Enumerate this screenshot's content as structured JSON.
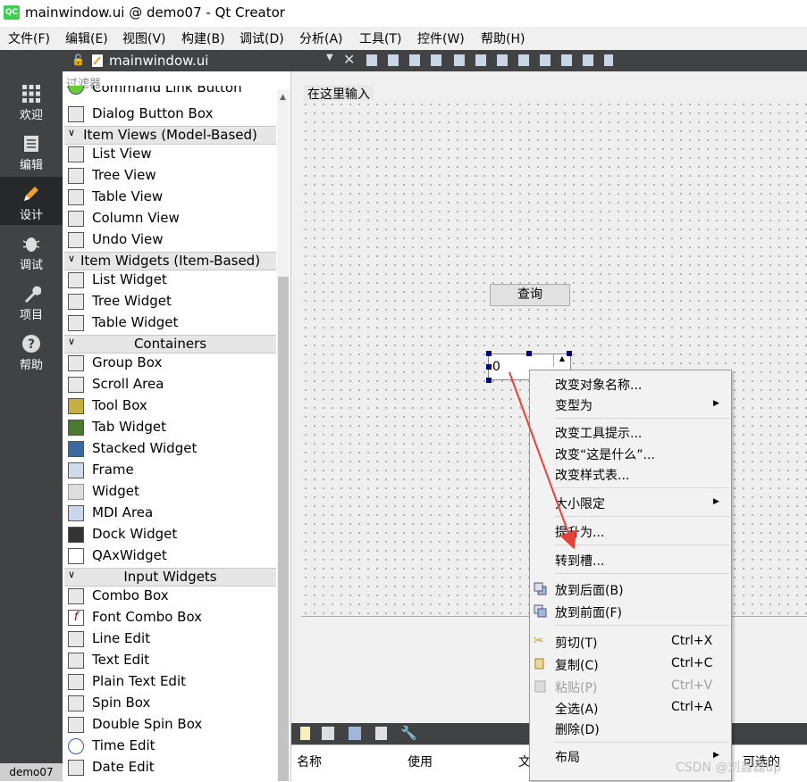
{
  "window": {
    "title": "mainwindow.ui @ demo07 - Qt Creator",
    "logo_text": "QC"
  },
  "menubar": {
    "items": [
      "文件(F)",
      "编辑(E)",
      "视图(V)",
      "构建(B)",
      "调试(D)",
      "分析(A)",
      "工具(T)",
      "控件(W)",
      "帮助(H)"
    ]
  },
  "modes": [
    "欢迎",
    "编辑",
    "设计",
    "调试",
    "项目",
    "帮助"
  ],
  "mode_footer": "demo07",
  "editor": {
    "file_name": "mainwindow.ui"
  },
  "widget_box": {
    "filter_placeholder": "过滤器",
    "partial_top": "Command Link Button",
    "dialog_button_box": "Dialog Button Box",
    "categories": {
      "item_views": "Item Views (Model-Based)",
      "item_widgets": "Item Widgets (Item-Based)",
      "containers": "Containers",
      "input_widgets": "Input Widgets"
    },
    "item_views": [
      "List View",
      "Tree View",
      "Table View",
      "Column View",
      "Undo View"
    ],
    "item_widgets": [
      "List Widget",
      "Tree Widget",
      "Table Widget"
    ],
    "containers": [
      "Group Box",
      "Scroll Area",
      "Tool Box",
      "Tab Widget",
      "Stacked Widget",
      "Frame",
      "Widget",
      "MDI Area",
      "Dock Widget",
      "QAxWidget"
    ],
    "input_widgets": [
      "Combo Box",
      "Font Combo Box",
      "Line Edit",
      "Text Edit",
      "Plain Text Edit",
      "Spin Box",
      "Double Spin Box",
      "Time Edit",
      "Date Edit"
    ]
  },
  "form": {
    "menu_placeholder": "在这里输入",
    "query_button": "查询",
    "spin_value": "0"
  },
  "action_editor": {
    "columns": [
      "名称",
      "使用",
      "文",
      "可选的"
    ]
  },
  "context_menu": {
    "change_object_name": "改变对象名称...",
    "morph_into": "变型为",
    "change_tooltip": "改变工具提示...",
    "change_whats_this": "改变“这是什么”...",
    "change_stylesheet": "改变样式表...",
    "size_constraints": "大小限定",
    "promote_to": "提升为...",
    "go_to_slot": "转到槽...",
    "send_to_back": "放到后面(B)",
    "bring_to_front": "放到前面(F)",
    "cut": "剪切(T)",
    "cut_shortcut": "Ctrl+X",
    "copy": "复制(C)",
    "copy_shortcut": "Ctrl+C",
    "paste": "粘贴(P)",
    "paste_shortcut": "Ctrl+V",
    "select_all": "全选(A)",
    "select_all_shortcut": "Ctrl+A",
    "delete": "删除(D)",
    "layout": "布局"
  },
  "watermark": "CSDN @刘鑫磊up",
  "colors": {
    "accent_arrow": "#e8413a",
    "modebar": "#404244",
    "selection_handle": "#00007f"
  }
}
